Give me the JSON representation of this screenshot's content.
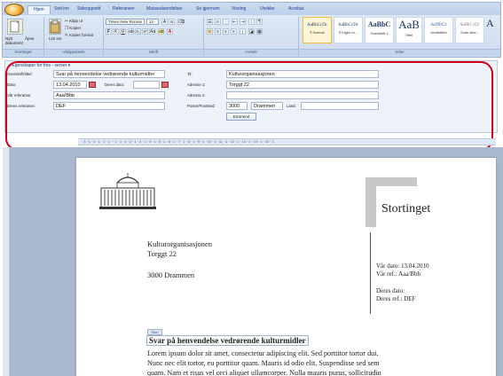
{
  "ribbon": {
    "tabs": [
      "Hjem",
      "Sett inn",
      "Sideoppsett",
      "Referanser",
      "Masseutsendelser",
      "Se gjennom",
      "Visning",
      "Utvikler",
      "Acrobat"
    ],
    "clipboard": {
      "paste": "Lim inn",
      "cut": "Klipp ut",
      "copy": "Kopier",
      "format_painter": "Kopier format",
      "label": "Utklippstavle"
    },
    "new_doc": {
      "line1": "Nytt",
      "line2": "dokument",
      "label": "Stortinget"
    },
    "open_btn": "Åpne",
    "font": {
      "name": "Times New Roman",
      "size": "12",
      "label": "Skrift",
      "bold": "F",
      "italic": "K",
      "underline": "U"
    },
    "paragraph": {
      "label": "Avsnitt"
    },
    "styles": {
      "label": "Stiler",
      "items": [
        {
          "sample": "AaBbCcDc",
          "name": "¶ Normal"
        },
        {
          "sample": "AaBbCcDc",
          "name": "¶ Ingen m..."
        },
        {
          "sample": "AaBbC",
          "name": "Overskrift 1"
        },
        {
          "sample": "AaB",
          "name": "Tittel"
        },
        {
          "sample": "AaBbCc",
          "name": "Undertittel"
        },
        {
          "sample": "AaBbCcDc",
          "name": "Svak uthe..."
        }
      ]
    }
  },
  "panel": {
    "title": "Egenskaper for fres - server",
    "labels": {
      "subject": "Overskrift/tittel:",
      "date": "Dato:",
      "your_date": "Deres dato:",
      "our_ref": "Vår referanse:",
      "your_ref": "Deres referanse:",
      "to": "Til:",
      "address1": "Adresse 1:",
      "address2": "Adresse 2:",
      "postal": "Postnr/Poststed:",
      "country": "Land:"
    },
    "values": {
      "subject": "Svar på henvendelse vedrørende kulturmidler",
      "date": "13.04.2010",
      "our_ref": "Aaa/Bbb",
      "your_ref": "DEF",
      "to": "Kulturorganisasjonen",
      "address1": "Torggt 22",
      "postal_code": "3000",
      "city": "Drammen"
    },
    "button": "Errorrend"
  },
  "ruler": {
    "numbers": "· 3 · 1 · 2 · 1 · 1 · 1 ·  · 1 · 1 · 1 · 2 · 1 · 3 · 1 · 4 · 1 · 5 · 1 · 6 · 1 · 7 · 1 · 8 · 1 · 9 · 1 · 10 · 1 · 11 · 1 · 12 · 1 · 13 · 1 · 14 · 1 · 15 · 1"
  },
  "document": {
    "logo": "Stortinget",
    "recipient": {
      "name": "Kulturorganisasjonen",
      "street": "Torggt 22",
      "city": "3000 Drammen"
    },
    "meta": {
      "our_date": "Vår dato: 13.04.2010",
      "our_ref": "Vår ref.: Aaa/Bbb",
      "your_date": "Deres dato:",
      "your_ref": "Deres ref.: DEF"
    },
    "title_tag": "Tittel",
    "heading": "Svar på henvendelse vedrørende kulturmidler",
    "body_lines": [
      "Lorem ipsum dolor sit amet, consectetur adipiscing elit. Sed porttitor tortor dui.",
      "Nunc nec elit tortor, eu porttitor quam. Mauris id odio elit. Suspendisse sed sem",
      "quam. Nam et risus vel orci aliquet ullamcorper. Nulla mauris purus, sollicitudin"
    ]
  },
  "colors": {
    "highlight": "#d2001a",
    "ribbon_text": "#15428b"
  }
}
